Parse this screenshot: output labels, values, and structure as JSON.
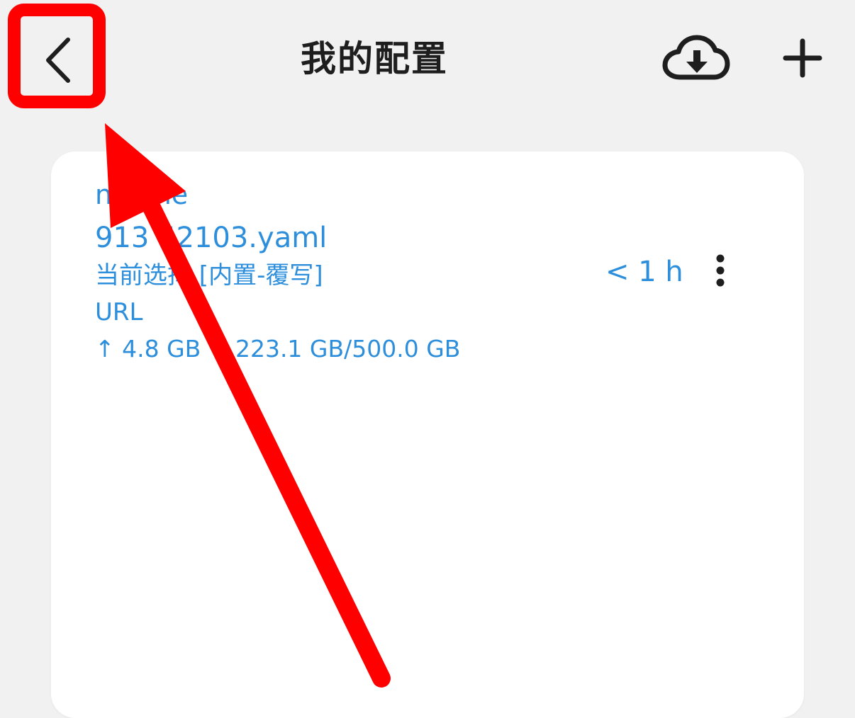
{
  "header": {
    "title": "我的配置",
    "back_icon": "chevron-left-icon",
    "download_icon": "cloud-download-icon",
    "add_icon": "plus-icon"
  },
  "profile": {
    "name": "n   x.me",
    "file": "913  52103.yaml",
    "selection": "当前选择 [内置-覆写]",
    "type": "URL",
    "traffic": "↑ 4.8 GB ↓ 223.1 GB/500.0 GB",
    "updated": "< 1 h",
    "more_icon": "more-vertical-icon"
  },
  "annotation": {
    "highlight_color": "#ff0000",
    "arrow_icon": "arrow-pointer-icon"
  },
  "colors": {
    "background": "#f1f1f1",
    "card": "#ffffff",
    "text_dark": "#1e1e1e",
    "accent_blue": "#2d8fdc",
    "annotation_red": "#ff0000"
  }
}
